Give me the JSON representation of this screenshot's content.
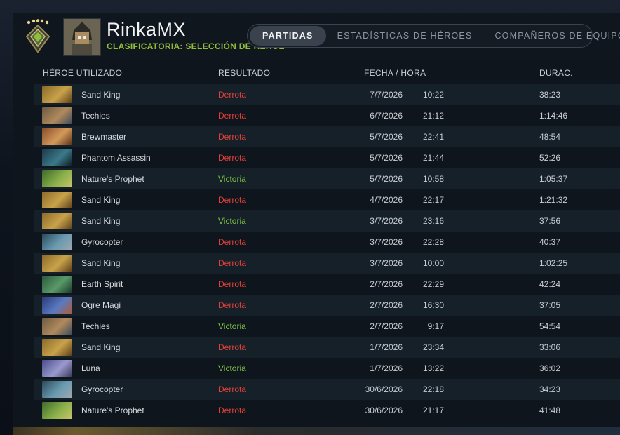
{
  "player": {
    "name": "RinkaMX",
    "mode": "CLASIFICATORIA: SELECCIÓN DE HÉROE"
  },
  "tabs": [
    {
      "label": "PARTIDAS",
      "active": true
    },
    {
      "label": "ESTADÍSTICAS DE HÉROES",
      "active": false
    },
    {
      "label": "COMPAÑEROS DE EQUIPO",
      "active": false
    }
  ],
  "columns": {
    "hero": "HÉROE UTILIZADO",
    "result": "RESULTADO",
    "datetime": "FECHA / HORA",
    "duration": "DURAC."
  },
  "colors": {
    "loss": "#e0413a",
    "win": "#7cc044",
    "mode": "#8fbf3a"
  },
  "matches": [
    {
      "hero": "Sand King",
      "result": "Derrota",
      "date": "7/7/2026",
      "time": "10:22",
      "duration": "38:23"
    },
    {
      "hero": "Techies",
      "result": "Derrota",
      "date": "6/7/2026",
      "time": "21:12",
      "duration": "1:14:46"
    },
    {
      "hero": "Brewmaster",
      "result": "Derrota",
      "date": "5/7/2026",
      "time": "22:41",
      "duration": "48:54"
    },
    {
      "hero": "Phantom Assassin",
      "result": "Derrota",
      "date": "5/7/2026",
      "time": "21:44",
      "duration": "52:26"
    },
    {
      "hero": "Nature's Prophet",
      "result": "Victoria",
      "date": "5/7/2026",
      "time": "10:58",
      "duration": "1:05:37"
    },
    {
      "hero": "Sand King",
      "result": "Derrota",
      "date": "4/7/2026",
      "time": "22:17",
      "duration": "1:21:32"
    },
    {
      "hero": "Sand King",
      "result": "Victoria",
      "date": "3/7/2026",
      "time": "23:16",
      "duration": "37:56"
    },
    {
      "hero": "Gyrocopter",
      "result": "Derrota",
      "date": "3/7/2026",
      "time": "22:28",
      "duration": "40:37"
    },
    {
      "hero": "Sand King",
      "result": "Derrota",
      "date": "3/7/2026",
      "time": "10:00",
      "duration": "1:02:25"
    },
    {
      "hero": "Earth Spirit",
      "result": "Derrota",
      "date": "2/7/2026",
      "time": "22:29",
      "duration": "42:24"
    },
    {
      "hero": "Ogre Magi",
      "result": "Derrota",
      "date": "2/7/2026",
      "time": "16:30",
      "duration": "37:05"
    },
    {
      "hero": "Techies",
      "result": "Victoria",
      "date": "2/7/2026",
      "time": "9:17",
      "duration": "54:54"
    },
    {
      "hero": "Sand King",
      "result": "Derrota",
      "date": "1/7/2026",
      "time": "23:34",
      "duration": "33:06"
    },
    {
      "hero": "Luna",
      "result": "Victoria",
      "date": "1/7/2026",
      "time": "13:22",
      "duration": "36:02"
    },
    {
      "hero": "Gyrocopter",
      "result": "Derrota",
      "date": "30/6/2026",
      "time": "22:18",
      "duration": "34:23"
    },
    {
      "hero": "Nature's Prophet",
      "result": "Derrota",
      "date": "30/6/2026",
      "time": "21:17",
      "duration": "41:48"
    }
  ]
}
